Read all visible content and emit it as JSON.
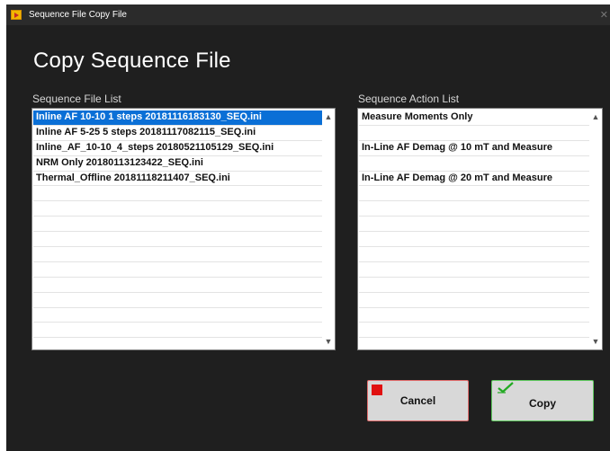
{
  "window": {
    "title": "Sequence File Copy File",
    "close_glyph": "✕"
  },
  "heading": "Copy Sequence File",
  "file_list": {
    "label": "Sequence File List",
    "items": [
      "Inline AF 10-10 1 steps 20181116183130_SEQ.ini",
      "Inline AF 5-25 5 steps 20181117082115_SEQ.ini",
      "Inline_AF_10-10_4_steps 20180521105129_SEQ.ini",
      "NRM Only 20180113123422_SEQ.ini",
      "Thermal_Offline 20181118211407_SEQ.ini",
      "",
      "",
      "",
      "",
      "",
      "",
      "",
      "",
      "",
      "",
      ""
    ],
    "selected_index": 0
  },
  "action_list": {
    "label": "Sequence Action List",
    "items": [
      "Measure Moments Only",
      "",
      "In-Line AF Demag @ 10 mT and Measure",
      "",
      "In-Line AF Demag @ 20 mT and Measure",
      "",
      "",
      "",
      "",
      "",
      "",
      "",
      "",
      "",
      "",
      ""
    ]
  },
  "buttons": {
    "cancel": {
      "label": "Cancel",
      "icon": "stop-icon",
      "border_color": "#e26d6d"
    },
    "copy": {
      "label": "Copy",
      "icon": "check-icon",
      "border_color": "#5fc95f"
    }
  },
  "colors": {
    "window_bg": "#1f1f1f",
    "selection": "#0a6fd6",
    "title_bar": "#2b2b2b"
  },
  "icons": {
    "scroll_up": "▲",
    "scroll_down": "▼"
  }
}
